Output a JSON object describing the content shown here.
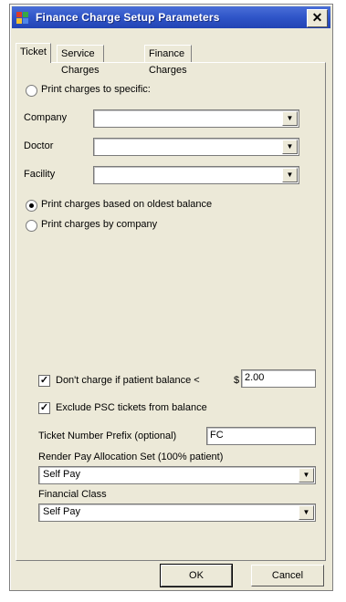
{
  "window": {
    "title": "Finance Charge Setup Parameters",
    "close_glyph": "✕"
  },
  "tabs": [
    "Ticket",
    "Service Charges",
    "Finance Charges"
  ],
  "options": {
    "print_by_specific": "Print charges to specific:",
    "company_label": "Company",
    "doctor_label": "Doctor",
    "facility_label": "Facility",
    "company_value": "",
    "doctor_value": "",
    "facility_value": "",
    "print_oldest": "Print charges based on oldest balance",
    "print_by_company": "Print charges by company"
  },
  "settings": {
    "dont_charge_label": "Don't charge if patient balance <",
    "currency_symbol": "$",
    "dont_charge_value": "2.00",
    "exclude_label": "Exclude PSC tickets from balance",
    "prefix_label": "Ticket Number Prefix (optional)",
    "prefix_value": "FC",
    "allocation_label": "Render Pay Allocation Set (100% patient)",
    "allocation_value": "Self Pay",
    "financial_class_label": "Financial Class",
    "financial_class_value": "Self Pay"
  },
  "buttons": {
    "ok": "OK",
    "cancel": "Cancel"
  },
  "state": {
    "radio_selected": "print_oldest",
    "dont_charge_checked": true,
    "exclude_checked": true
  },
  "colors": {
    "titlebar": "#2f55c8",
    "dialog_bg": "#ece9d8"
  }
}
